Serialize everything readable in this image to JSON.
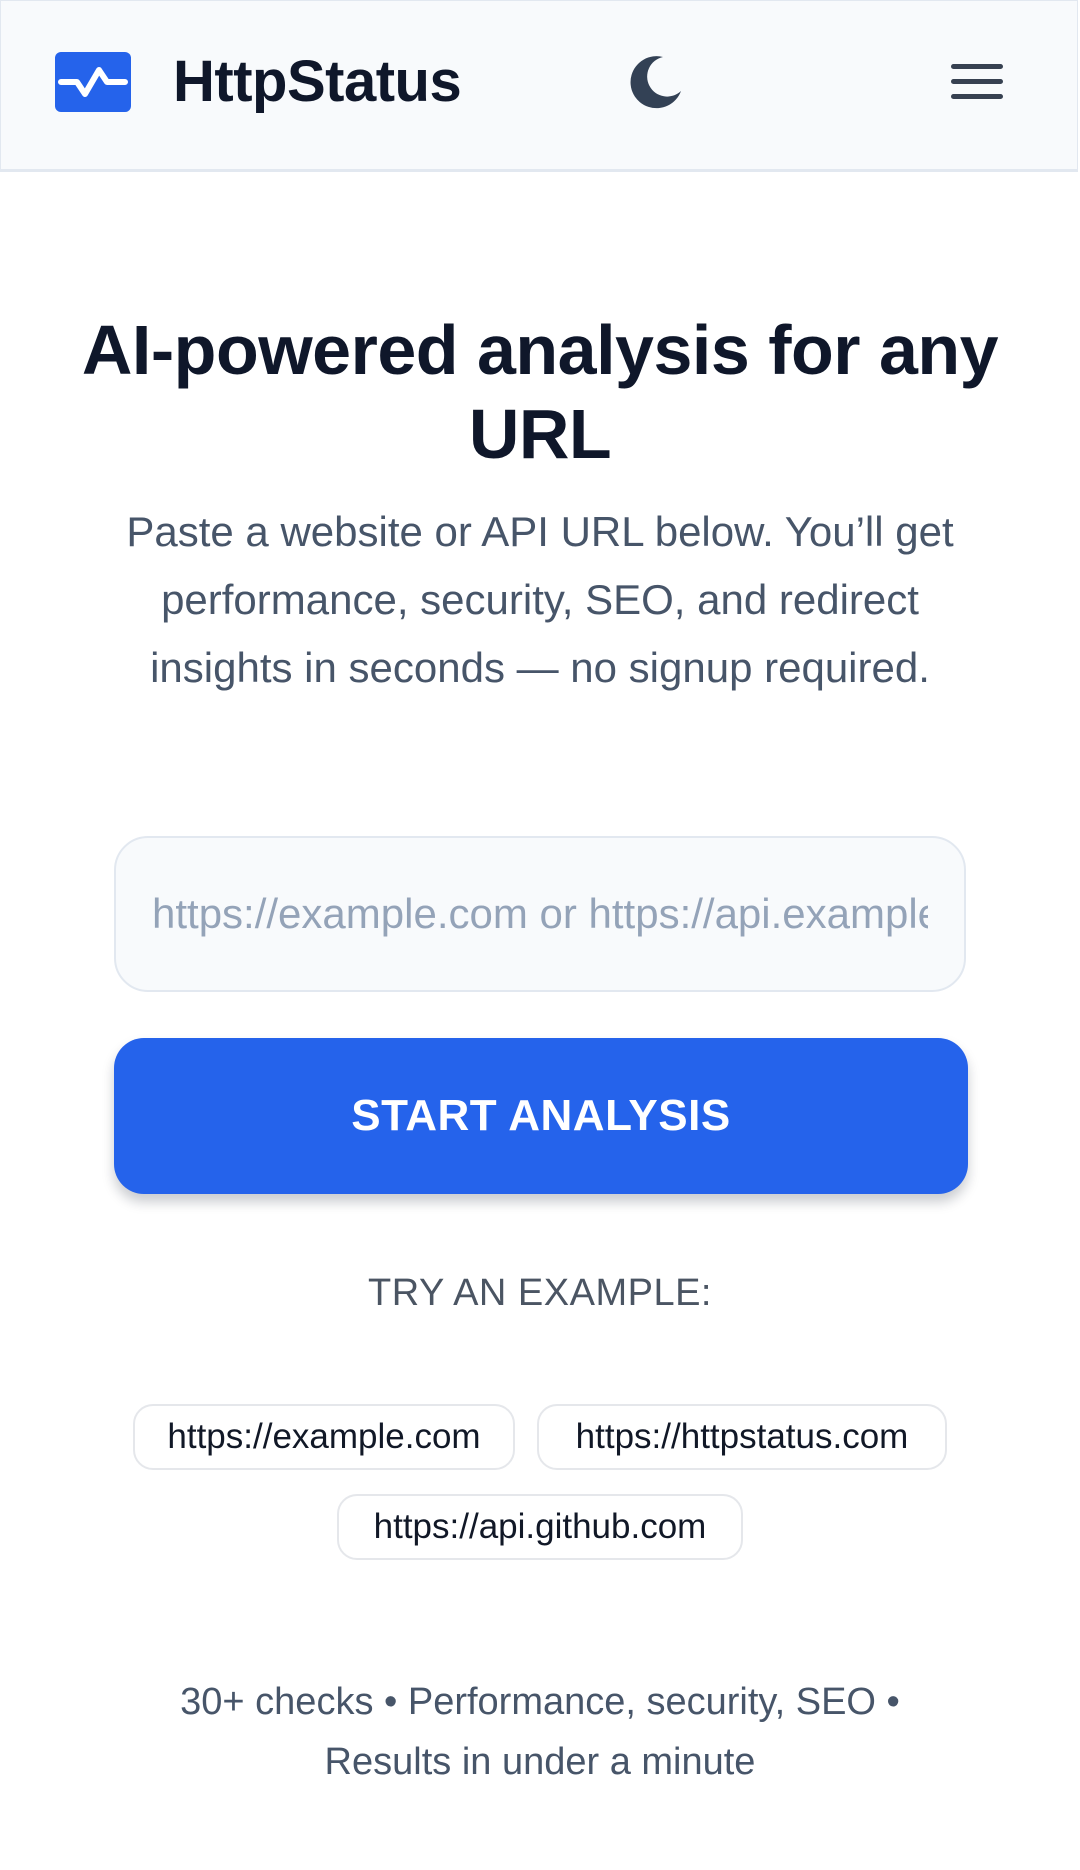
{
  "header": {
    "brand": "HttpStatus",
    "logo_icon": "activity-pulse-icon",
    "theme_icon": "moon-icon",
    "menu_icon": "hamburger-menu-icon"
  },
  "hero": {
    "title": "AI-powered analysis for any URL",
    "subtitle": "Paste a website or API URL below. You’ll get performance, security, SEO, and redirect insights in seconds — no signup required."
  },
  "form": {
    "url_placeholder": "https://example.com or https://api.example.com",
    "url_value": "",
    "submit_label": "START ANALYSIS"
  },
  "examples": {
    "label": "TRY AN EXAMPLE:",
    "items": [
      "https://example.com",
      "https://httpstatus.com",
      "https://api.github.com"
    ]
  },
  "footer_note": "30+ checks • Performance, security, SEO • Results in under a minute",
  "colors": {
    "accent": "#2563eb",
    "heading": "#0f172a",
    "muted_text": "#475569",
    "header_bg": "#f8fafc",
    "border": "#e2e8f0"
  }
}
